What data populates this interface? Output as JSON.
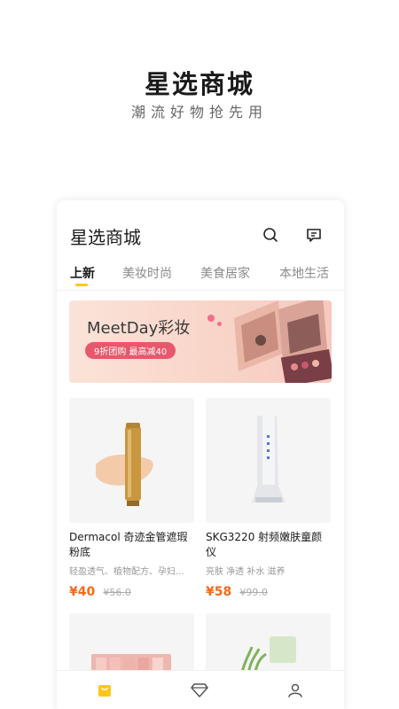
{
  "promo": {
    "title": "星选商城",
    "subtitle": "潮流好物抢先用"
  },
  "app": {
    "title": "星选商城",
    "icons": {
      "search": "search-icon",
      "message": "message-icon"
    }
  },
  "tabs": [
    {
      "label": "上新",
      "active": true
    },
    {
      "label": "美妆时尚",
      "active": false
    },
    {
      "label": "美食居家",
      "active": false
    },
    {
      "label": "本地生活",
      "active": false
    }
  ],
  "banner": {
    "brand": "MeetDay彩妆",
    "promo": "9折团购 最高减40",
    "slides": 3,
    "active_slide": 1
  },
  "products": [
    {
      "name": "Dermacol 奇迹金管遮瑕粉底",
      "tags": "轻盈透气、植物配方、孕妇...",
      "price": "¥40",
      "original_price": "¥56.0"
    },
    {
      "name": "SKG3220 射频嫩肤童颜仪",
      "tags": "亮肤 净透 补水 滋养",
      "price": "¥58",
      "original_price": "¥99.0"
    },
    {
      "name": "",
      "tags": "",
      "price": "",
      "original_price": ""
    },
    {
      "name": "",
      "tags": "",
      "price": "",
      "original_price": ""
    }
  ],
  "bottom_nav": [
    {
      "icon": "bag-icon",
      "active": true
    },
    {
      "icon": "diamond-icon",
      "active": false
    },
    {
      "icon": "user-icon",
      "active": false
    }
  ],
  "colors": {
    "accent": "#FFC61A",
    "price": "#F26A1B",
    "banner_pill": "#E8586C"
  }
}
